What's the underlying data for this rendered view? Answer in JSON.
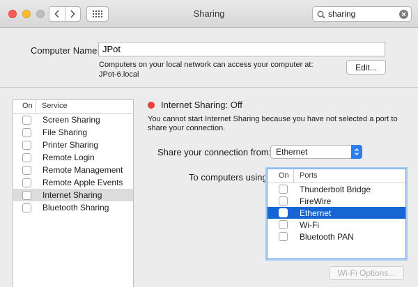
{
  "window": {
    "title": "Sharing"
  },
  "toolbar": {
    "back_icon": "chevron-left-icon",
    "forward_icon": "chevron-right-icon",
    "grid_icon": "grid-icon"
  },
  "search": {
    "value": "sharing",
    "icon": "magnifier-icon",
    "clear_icon": "clear-icon"
  },
  "computer_name": {
    "label": "Computer Name:",
    "value": "JPot",
    "help_line1": "Computers on your local network can access your computer at:",
    "help_line2": "JPot-6.local",
    "edit_label": "Edit..."
  },
  "services": {
    "header_on": "On",
    "header_service": "Service",
    "selected": "Internet Sharing",
    "items": [
      {
        "label": "Screen Sharing",
        "checked": false
      },
      {
        "label": "File Sharing",
        "checked": false
      },
      {
        "label": "Printer Sharing",
        "checked": false
      },
      {
        "label": "Remote Login",
        "checked": false
      },
      {
        "label": "Remote Management",
        "checked": false
      },
      {
        "label": "Remote Apple Events",
        "checked": false
      },
      {
        "label": "Internet Sharing",
        "checked": false
      },
      {
        "label": "Bluetooth Sharing",
        "checked": false
      }
    ]
  },
  "detail": {
    "status_color": "#e8423b",
    "status_title": "Internet Sharing: Off",
    "status_msg_line1": "You cannot start Internet Sharing because you have not selected a port to",
    "status_msg_line2": "share your connection.",
    "share_from_label": "Share your connection from:",
    "share_from_value": "Ethernet",
    "to_computers_label": "To computers using:",
    "wifi_options_label": "Wi-Fi Options..."
  },
  "ports": {
    "header_on": "On",
    "header_ports": "Ports",
    "selected": "Ethernet",
    "items": [
      {
        "label": "Thunderbolt Bridge",
        "checked": false
      },
      {
        "label": "FireWire",
        "checked": false
      },
      {
        "label": "Ethernet",
        "checked": false
      },
      {
        "label": "Wi-Fi",
        "checked": false
      },
      {
        "label": "Bluetooth PAN",
        "checked": false
      }
    ]
  },
  "colors": {
    "accent": "#2c7df0",
    "selection": "#1765d4"
  }
}
